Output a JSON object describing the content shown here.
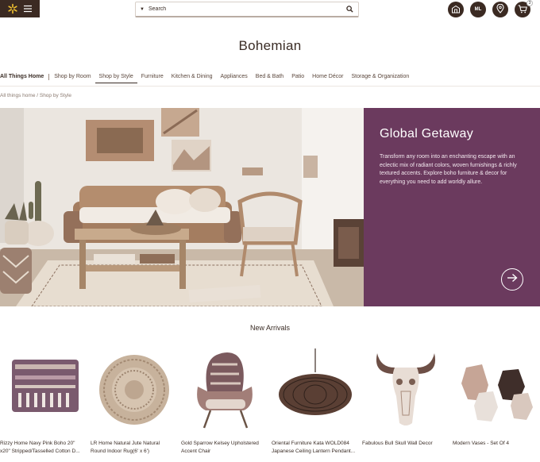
{
  "header": {
    "search_placeholder": "Search",
    "account_initials": "ML",
    "cart_count": "3",
    "icons": [
      "spark-logo-icon",
      "menu-icon",
      "search-icon",
      "store-icon",
      "location-icon",
      "cart-icon"
    ]
  },
  "page_title": "Bohemian",
  "nav": {
    "items": [
      "All Things Home",
      "Shop by Room",
      "Shop by Style",
      "Furniture",
      "Kitchen & Dining",
      "Appliances",
      "Bed & Bath",
      "Patio",
      "Home Décor",
      "Storage & Organization"
    ],
    "active": "Shop by Style"
  },
  "breadcrumb": "All things home / Shop by Style",
  "hero": {
    "heading": "Global Getaway",
    "body": "Transform any room into an enchanting escape with an eclectic mix of radiant colors, woven furnishings & richly textured accents. Explore boho furniture & decor for everything you need to add worldly allure.",
    "accent_color": "#6b3a5e"
  },
  "new_arrivals": {
    "title": "New Arrivals",
    "products": [
      {
        "line1": "Rizzy Home Navy Pink Boho 20\"",
        "line2": "x20\" Stripped/Tasselled Cotton D..."
      },
      {
        "line1": "LR Home Natural Jute Natural",
        "line2": "Round Indoor Rug(6' x 6')"
      },
      {
        "line1": "Gold Sparrow Kelsey Upholstered",
        "line2": "Accent Chair"
      },
      {
        "line1": "Oriental Furniture Kata WOLD084",
        "line2": "Japanese Ceiling Lantern Pendant..."
      },
      {
        "line1": "Fabulous Bull Skull Wall Decor",
        "line2": ""
      },
      {
        "line1": "Modern Vases - Set Of 4",
        "line2": ""
      }
    ]
  }
}
